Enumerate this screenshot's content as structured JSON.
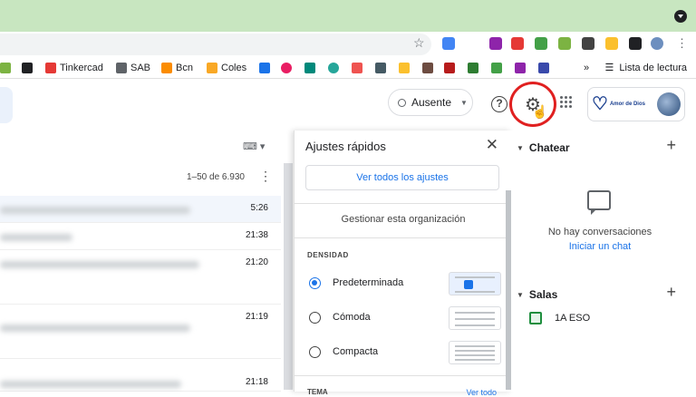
{
  "browser": {
    "bookmarks": [
      {
        "label": "",
        "color": "#7cb342"
      },
      {
        "label": "",
        "color": "#202124"
      },
      {
        "label": "Tinkercad",
        "color": "#e53935"
      },
      {
        "label": "SAB",
        "color": "#5f6368"
      },
      {
        "label": "Bcn",
        "color": "#fb8c00"
      },
      {
        "label": "Coles",
        "color": "#f9a825"
      }
    ],
    "reading_list": "Lista de lectura",
    "more": "»"
  },
  "gmail": {
    "status": {
      "label": "Ausente"
    },
    "help_icon": "?",
    "pagination": "1–50 de 6.930",
    "rows": [
      {
        "time": "5:26",
        "selected": true
      },
      {
        "time": "21:38",
        "selected": false
      },
      {
        "time": "21:20",
        "selected": false
      },
      {
        "time": "21:19",
        "selected": false
      },
      {
        "time": "21:18",
        "selected": false
      }
    ]
  },
  "quick_settings": {
    "title": "Ajustes rápidos",
    "close": "✕",
    "all_settings_button": "Ver todos los ajustes",
    "manage_org": "Gestionar esta organización",
    "density_heading": "DENSIDAD",
    "options": [
      {
        "label": "Predeterminada",
        "selected": true
      },
      {
        "label": "Cómoda",
        "selected": false
      },
      {
        "label": "Compacta",
        "selected": false
      }
    ],
    "theme_heading": "TEMA",
    "theme_link": "Ver todo"
  },
  "chat": {
    "heading": "Chatear",
    "no_conversations": "No hay conversaciones",
    "start_chat": "Iniciar un chat",
    "rooms_heading": "Salas",
    "rooms": [
      {
        "label": "1A ESO"
      }
    ]
  },
  "account": {
    "org_name": "Amor de Dios"
  },
  "colors": {
    "accent": "#1a73e8",
    "highlight_ring": "#e02020",
    "topbar": "#c8e6c0"
  }
}
